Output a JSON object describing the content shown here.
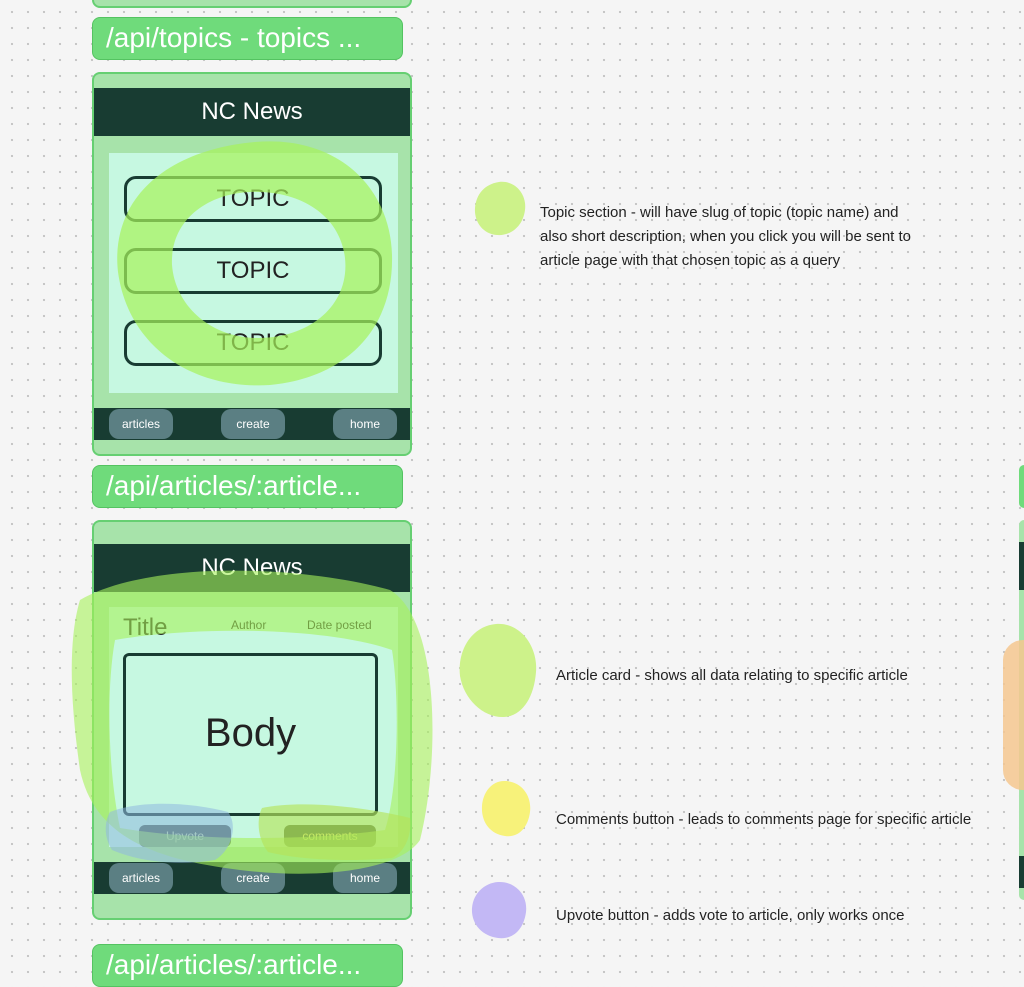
{
  "routes": {
    "topics_label": "/api/topics - topics ...",
    "article_label": "/api/articles/:article...",
    "bottom_label": "/api/articles/:article..."
  },
  "topics_frame": {
    "header": "NC News",
    "topics": [
      "TOPIC",
      "TOPIC",
      "TOPIC"
    ],
    "nav": {
      "articles": "articles",
      "create": "create",
      "home": "home"
    }
  },
  "article_frame": {
    "header": "NC News",
    "title": "Title",
    "author": "Author",
    "date": "Date posted",
    "body": "Body",
    "upvote": "Upvote",
    "comments": "comments",
    "nav": {
      "articles": "articles",
      "create": "create",
      "home": "home"
    }
  },
  "annotations": {
    "topic_section": "Topic section - will have slug of topic (topic name) and also short description, when you click you will be sent to article page with that chosen topic as a query",
    "article_card": "Article card - shows all data relating to specific article",
    "comments_button": "Comments button - leads to comments page for specific article",
    "upvote_button": "Upvote button - adds vote to article, only works once"
  },
  "colors": {
    "route_label": "#6fdb7b",
    "frame": "#a7e3aa",
    "header": "#183c32",
    "panel": "#c6f8e1",
    "nav_button": "#5b7f83",
    "highlight_green": "#a6f25a",
    "marker_yellow": "#f7f27a",
    "marker_purple": "#c3b8f5",
    "marker_orange": "#f5c78f"
  }
}
